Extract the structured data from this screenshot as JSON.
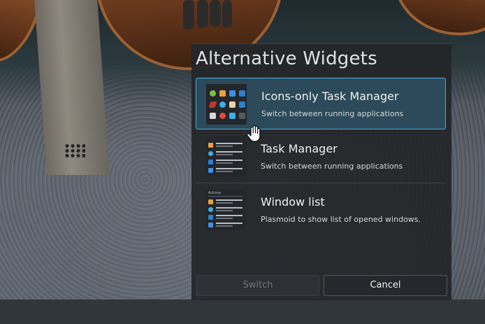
{
  "dialog": {
    "title": "Alternative Widgets",
    "items": [
      {
        "name": "Icons-only Task Manager",
        "description": "Switch between running applications",
        "selected": true,
        "thumbnail_icon": "icon-grid-preview-icon"
      },
      {
        "name": "Task Manager",
        "description": "Switch between running applications",
        "selected": false,
        "thumbnail_icon": "task-list-preview-icon"
      },
      {
        "name": "Window list",
        "description": "Plasmoid to show list of opened windows.",
        "selected": false,
        "thumbnail_icon": "window-list-preview-icon",
        "thumbnail_header": "Actions"
      }
    ],
    "buttons": {
      "switch_label": "Switch",
      "switch_enabled": false,
      "cancel_label": "Cancel"
    }
  },
  "colors": {
    "accent": "#3daee9",
    "selected_bg": "#2c4a59",
    "dialog_bg": "#232629",
    "text": "#eef0f1"
  },
  "cursor": "open-hand-cursor-icon"
}
